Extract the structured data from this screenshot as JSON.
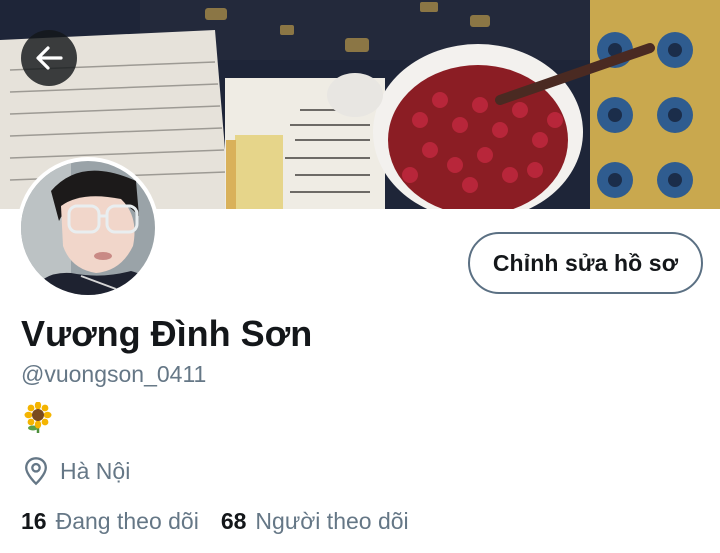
{
  "profile": {
    "display_name": "Vương Đình Sơn",
    "handle": "@vuongson_0411",
    "bio_icon": "sunflower-icon",
    "location": "Hà Nội",
    "following_count": "16",
    "following_label": "Đang theo dõi",
    "followers_count": "68",
    "followers_label": "Người theo dõi"
  },
  "actions": {
    "edit_profile_label": "Chỉnh sửa hồ sơ",
    "back_icon": "arrow-left-icon"
  },
  "colors": {
    "text_primary": "#14171a",
    "text_secondary": "#657786",
    "button_border": "#5b7083"
  }
}
